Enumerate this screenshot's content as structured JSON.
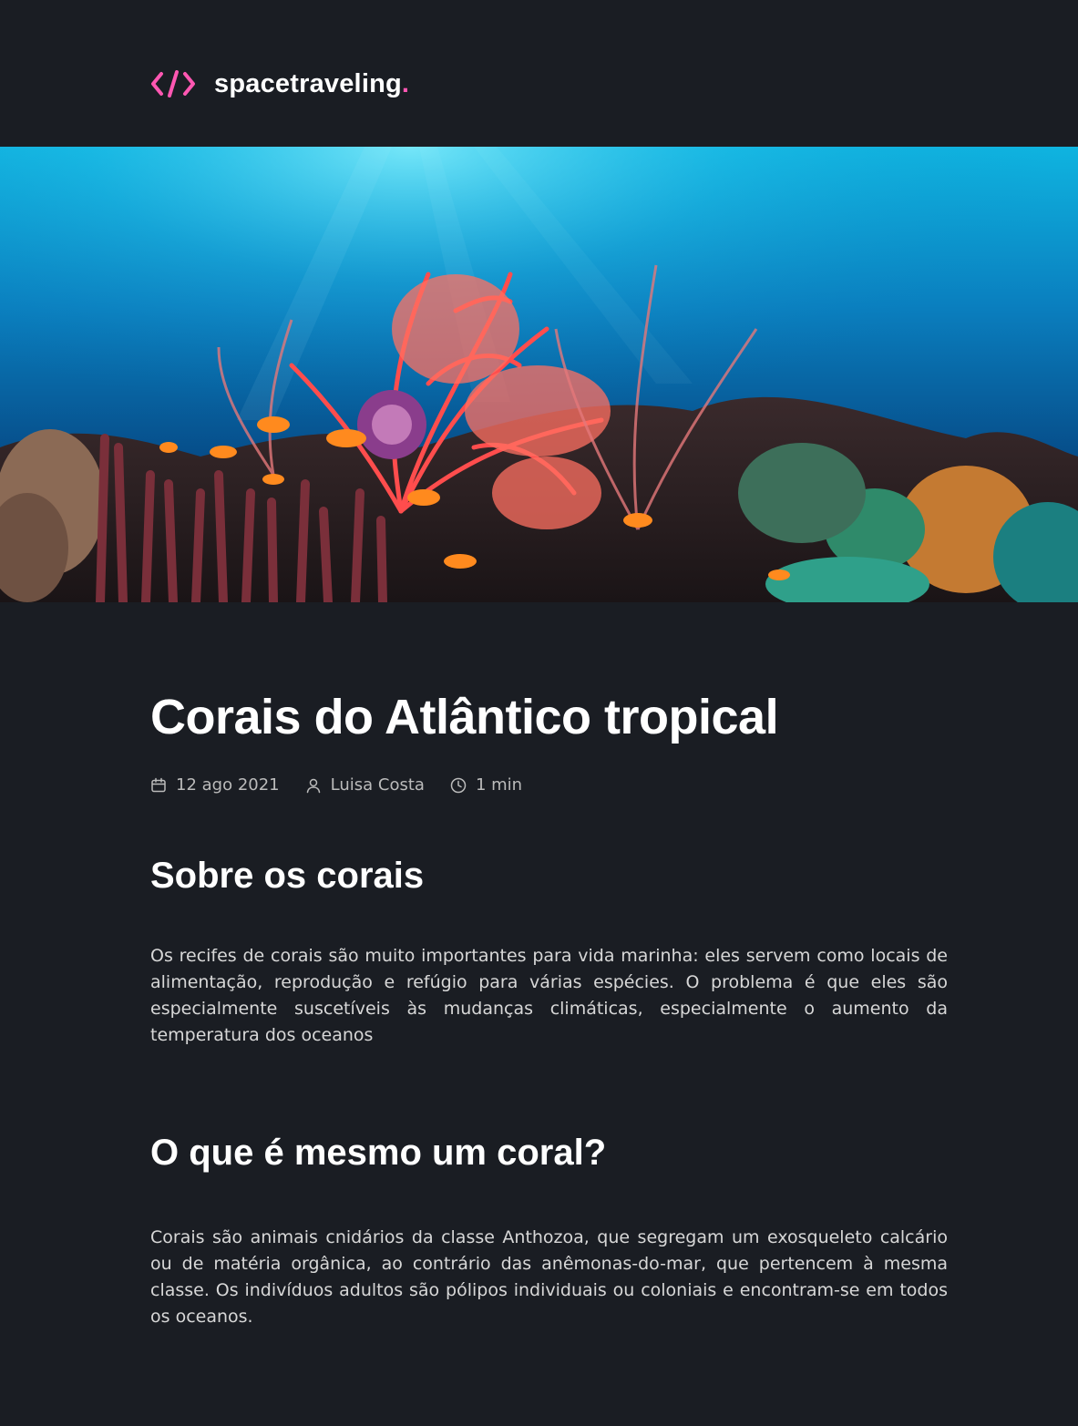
{
  "header": {
    "logo_icon": "code-brackets-icon",
    "brand_name": "spacetraveling",
    "brand_dot": ".",
    "accent_color": "#ff57b2"
  },
  "banner": {
    "image": "coral-reef-underwater-photo"
  },
  "post": {
    "title": "Corais do Atlântico tropical",
    "meta": {
      "date": "12 ago 2021",
      "author": "Luisa Costa",
      "reading_time": "1 min"
    },
    "content": [
      {
        "heading": "Sobre os corais",
        "body": "Os recifes de corais são muito importantes para vida marinha: eles servem como locais de alimentação, reprodução e refúgio para várias espécies. O problema é que eles são especialmente suscetíveis às mudanças climáticas, especialmente o aumento da temperatura dos oceanos"
      },
      {
        "heading": "O que é mesmo um coral?",
        "body": "Corais são animais cnidários da classe Anthozoa, que segregam um exosqueleto calcário ou de matéria orgânica, ao contrário das anêmonas-do-mar, que pertencem à mesma classe. Os indivíduos adultos são pólipos individuais ou coloniais e encontram-se em todos os oceanos."
      }
    ]
  },
  "colors": {
    "background": "#1a1d23",
    "heading": "#ffffff",
    "body_text": "#d7d7d7",
    "meta_text": "#bbbbbb"
  }
}
